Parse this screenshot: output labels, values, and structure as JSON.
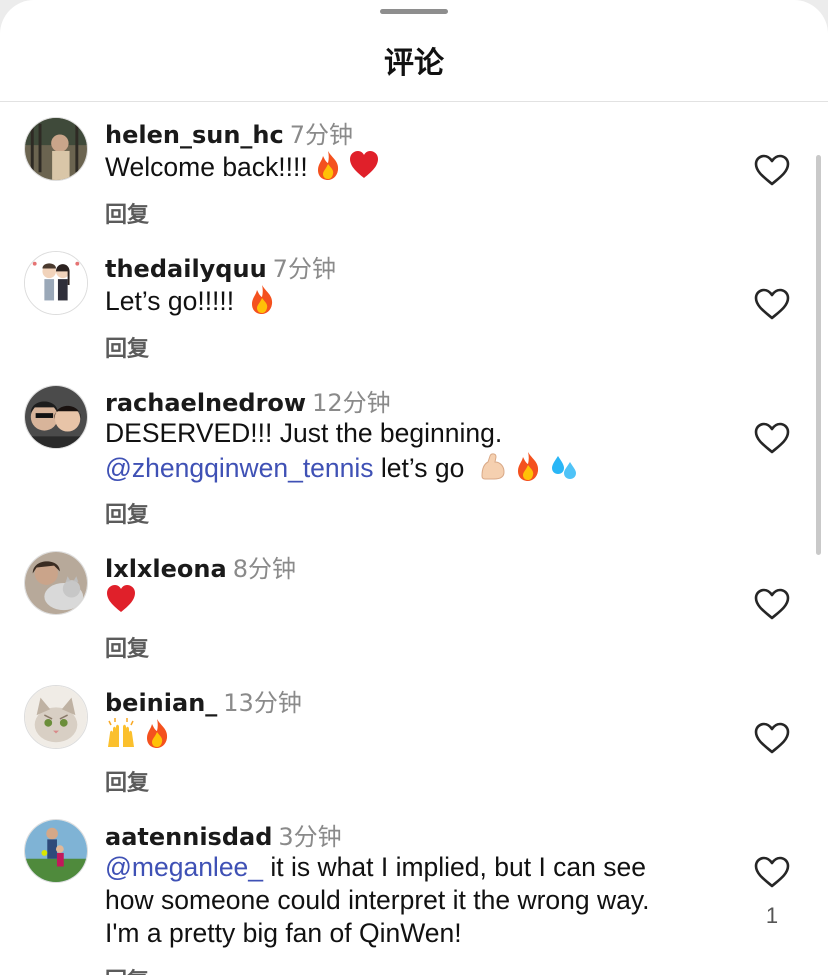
{
  "sheet": {
    "title": "评论"
  },
  "reply_label": "回复",
  "comments": [
    {
      "username": "helen_sun_hc",
      "time": "7分钟",
      "text": "Welcome back!!!!",
      "emojis": [
        "fire-emoji",
        "red-heart-emoji"
      ],
      "likes": ""
    },
    {
      "username": "thedailyquu",
      "time": "7分钟",
      "text": "Let’s go!!!!! ",
      "emojis": [
        "fire-emoji"
      ],
      "likes": ""
    },
    {
      "username": "rachaelnedrow",
      "time": "12分钟",
      "text_line1": "DESERVED!!! Just the beginning.",
      "mention": "@zhengqinwen_tennis",
      "text_line2": " let’s go ",
      "emojis": [
        "flexed-biceps-emoji",
        "fire-emoji",
        "sweat-droplets-emoji"
      ],
      "likes": ""
    },
    {
      "username": "lxlxleona",
      "time": "8分钟",
      "text": "",
      "emojis": [
        "red-heart-emoji"
      ],
      "likes": ""
    },
    {
      "username": "beinian_",
      "time": "13分钟",
      "text": "",
      "emojis": [
        "raising-hands-emoji",
        "fire-emoji"
      ],
      "likes": ""
    },
    {
      "username": "aatennisdad",
      "time": "3分钟",
      "mention": "@meganlee_",
      "text_line1": " it is what I implied, but I can see",
      "text_line2": "how someone could interpret it the wrong way.",
      "text_line3": "I'm a pretty big fan of QinWen!",
      "emojis": [],
      "likes": "1"
    }
  ],
  "colors": {
    "mention": "#3f51b5",
    "time": "#8a8a8a",
    "heart_outline": "#262626"
  }
}
